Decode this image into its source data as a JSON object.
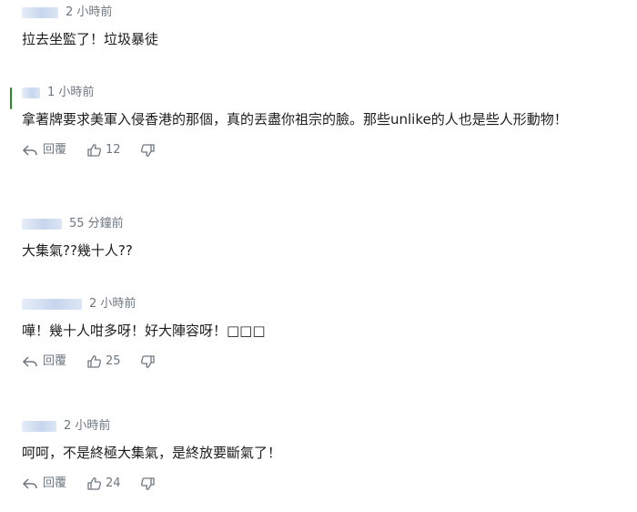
{
  "comments": [
    {
      "username": "",
      "time": "2 小時前",
      "text": "拉去坐監了！垃圾暴徒",
      "show_actions": false
    },
    {
      "username": "",
      "time": "1 小時前",
      "text": "拿著牌要求美軍入侵香港的那個，真的丟盡你祖宗的臉。那些unlike的人也是些人形動物！",
      "reply_label": "回覆",
      "like_count": "12",
      "show_actions": true
    },
    {
      "username": "",
      "time": "55 分鐘前",
      "text": "大集氣??幾十人??",
      "show_actions": false
    },
    {
      "username": "",
      "time": "2 小時前",
      "text": "嘩！幾十人咁多呀！好大陣容呀！□□□",
      "reply_label": "回覆",
      "like_count": "25",
      "show_actions": true
    },
    {
      "username": "",
      "time": "2 小時前",
      "text": "呵呵，不是終極大集氣，是終放要斷氣了！",
      "reply_label": "回覆",
      "like_count": "24",
      "show_actions": true
    }
  ],
  "icons": {
    "reply": "reply-arrow-icon",
    "like": "thumbs-up-icon",
    "dislike": "thumbs-down-icon"
  },
  "colors": {
    "text": "#1d1d1d",
    "meta": "#6e7780",
    "active_marker": "#2a8a2a"
  }
}
